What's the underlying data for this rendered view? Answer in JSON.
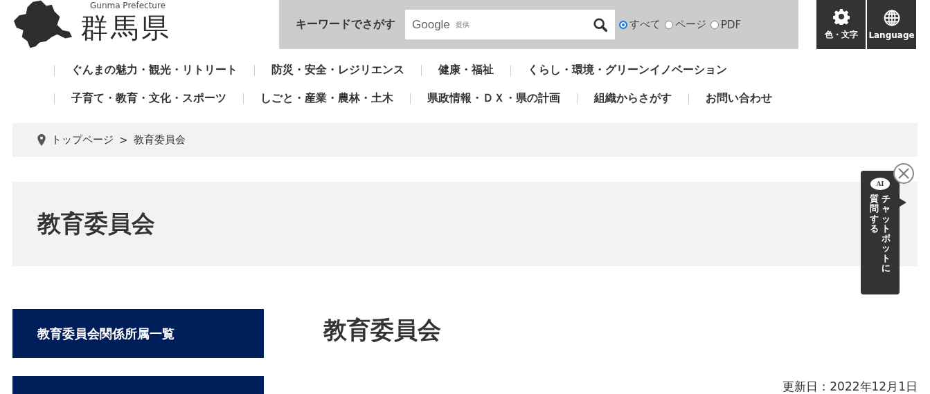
{
  "logo": {
    "subtitle": "Gunma Prefecture",
    "title": "群馬県"
  },
  "search": {
    "label": "キーワードでさがす",
    "provider": "Google",
    "provider_note": "提供",
    "options": [
      {
        "label": "すべて",
        "selected": true
      },
      {
        "label": "ページ",
        "selected": false
      },
      {
        "label": "PDF",
        "selected": false
      }
    ]
  },
  "tools": [
    {
      "label": "色・文字",
      "kind": "gear"
    },
    {
      "label": "Language",
      "kind": "globe"
    }
  ],
  "nav_rows": [
    [
      "ぐんまの魅力・観光・リトリート",
      "防災・安全・レジリエンス",
      "健康・福祉",
      "くらし・環境・グリーンイノベーション"
    ],
    [
      "子育て・教育・文化・スポーツ",
      "しごと・産業・農林・土木",
      "県政情報・ＤＸ・県の計画",
      "組織からさがす",
      "お問い合わせ"
    ]
  ],
  "breadcrumb": [
    {
      "label": "トップページ"
    },
    {
      "label": "教育委員会"
    }
  ],
  "breadcrumb_separator": ">",
  "page_title": "教育委員会",
  "sidebar": {
    "items": [
      {
        "kind": "link",
        "label": "教育委員会関係所属一覧"
      },
      {
        "kind": "cut_off"
      }
    ]
  },
  "content": {
    "heading": "教育委員会",
    "updated": "更新日：2022年12月1日"
  },
  "chatbot": {
    "badge": "AI",
    "columns": [
      "質問する",
      "チャットボットに"
    ]
  }
}
